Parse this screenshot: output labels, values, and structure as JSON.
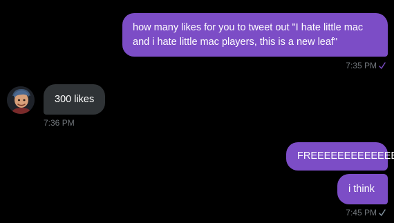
{
  "conversation": {
    "messages": [
      {
        "direction": "outgoing",
        "text": "how many likes for you to tweet out \"I hate little mac and i hate little mac players, this is a new leaf\"",
        "time": "7:35 PM",
        "status": "read"
      },
      {
        "direction": "incoming",
        "text": "300 likes",
        "time": "7:36 PM"
      },
      {
        "direction": "outgoing",
        "text": "FREEEEEEEEEEEEE"
      },
      {
        "direction": "outgoing",
        "text": "i think",
        "time": "7:45 PM",
        "status": "sent"
      }
    ]
  },
  "colors": {
    "outgoing_bubble": "#7c4dc6",
    "incoming_bubble": "#2f3336",
    "read_check": "#7c4dc6",
    "sent_check": "#8899a6",
    "timestamp": "#71767b",
    "background": "#000000"
  },
  "icons": {
    "read_receipt": "checkmark-icon",
    "sent_receipt": "checkmark-icon",
    "sender_avatar": "avatar"
  }
}
